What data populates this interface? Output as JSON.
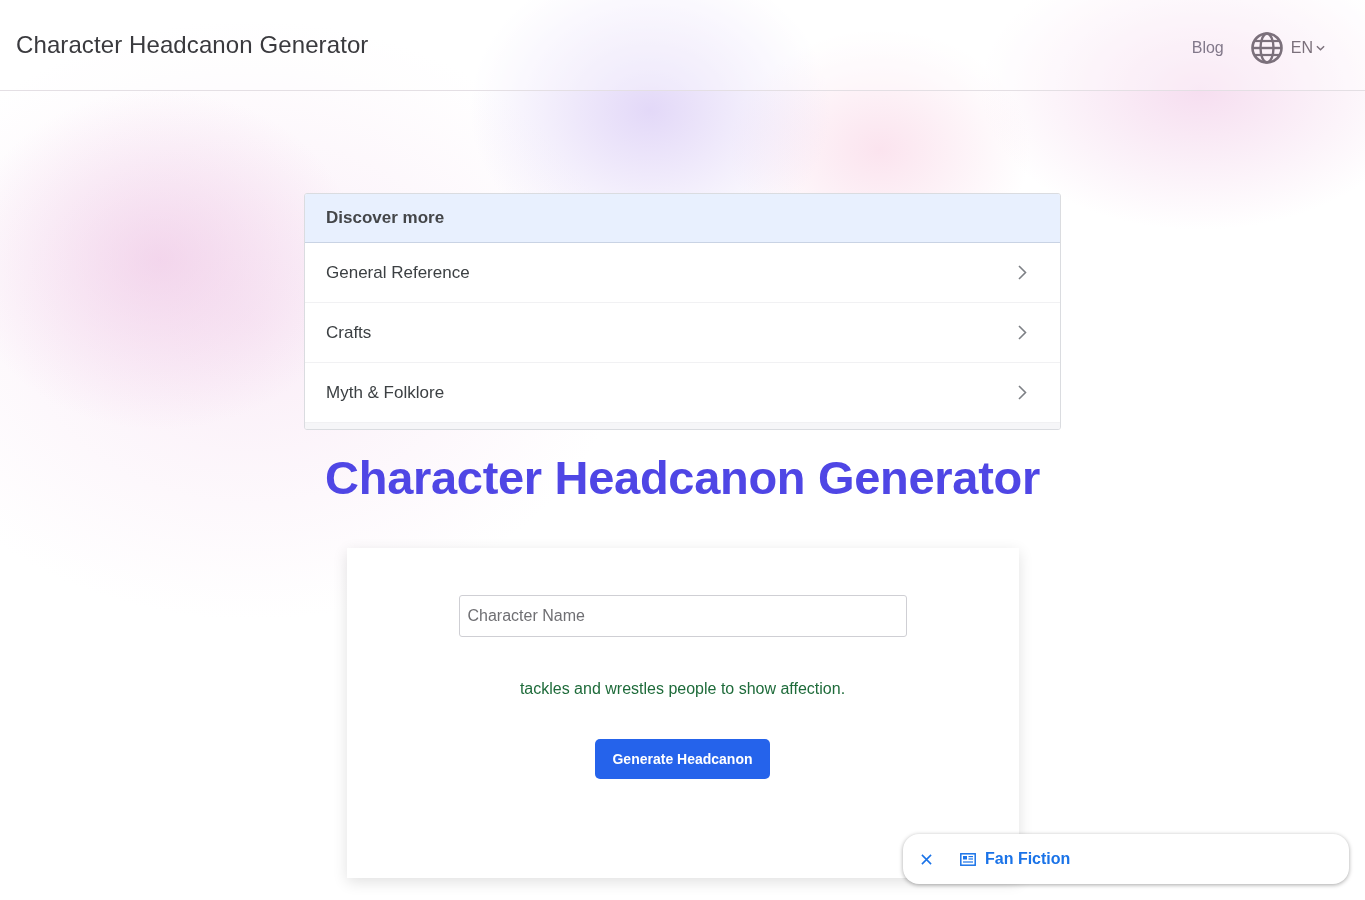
{
  "header": {
    "title": "Character Headcanon Generator",
    "nav_link": "Blog",
    "language": "EN"
  },
  "discover": {
    "title": "Discover more",
    "items": [
      "General Reference",
      "Crafts",
      "Myth & Folklore"
    ]
  },
  "heading": "Character Headcanon Generator",
  "form": {
    "name_field": {
      "placeholder": "Character Name"
    },
    "result": "tackles and wrestles people to show affection.",
    "button": "Generate Headcanon"
  },
  "suggestion_bar": {
    "label": "Fan Fiction"
  }
}
